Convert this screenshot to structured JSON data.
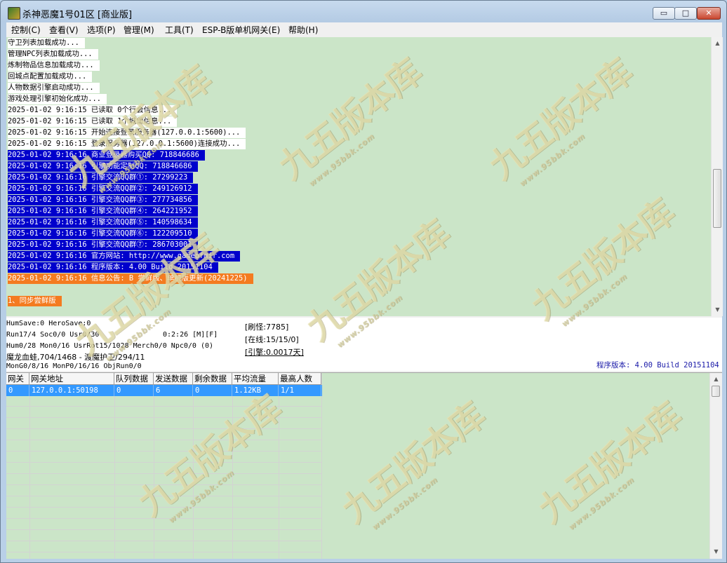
{
  "window": {
    "title": "杀神恶魔1号01区 [商业版]",
    "controls": {
      "minimize": "▭",
      "maximize": "□",
      "close": "✕"
    }
  },
  "menu": [
    "控制(C)",
    "查看(V)",
    "选项(P)",
    "管理(M)",
    "工具(T)",
    "ESP-B版单机网关(E)",
    "帮助(H)"
  ],
  "log": [
    {
      "text": "守卫列表加载成功...",
      "style": "white"
    },
    {
      "text": "管理NPC列表加载成功...",
      "style": "white"
    },
    {
      "text": "炼制物品信息加载成功...",
      "style": "white"
    },
    {
      "text": "回城点配置加载成功...",
      "style": "white"
    },
    {
      "text": "人物数据引擎启动成功...",
      "style": "white"
    },
    {
      "text": "游戏处理引擎初始化成功...",
      "style": "white"
    },
    {
      "text": "2025-01-02 9:16:15 已读取 0个行会信息...",
      "style": "white"
    },
    {
      "text": "2025-01-02 9:16:15 已读取 1个城堡信息...",
      "style": "white"
    },
    {
      "text": "2025-01-02 9:16:15 开始连接登录服务器(127.0.0.1:5600)...",
      "style": "white"
    },
    {
      "text": "2025-01-02 9:16:15 登录服务器(127.0.0.1:5600)连接成功...",
      "style": "white"
    },
    {
      "text": "2025-01-02 9:16:16 商业登录器购买QQ: 718846686",
      "style": "blue"
    },
    {
      "text": "2025-01-02 9:16:16 引擎功能定制QQ: 718846686",
      "style": "blue"
    },
    {
      "text": "2025-01-02 9:16:16 引擎交流QQ群①: 27299223",
      "style": "blue"
    },
    {
      "text": "2025-01-02 9:16:16 引擎交流QQ群②: 249126912",
      "style": "blue"
    },
    {
      "text": "2025-01-02 9:16:16 引擎交流QQ群③: 277734856",
      "style": "blue"
    },
    {
      "text": "2025-01-02 9:16:16 引擎交流QQ群④: 264221952",
      "style": "blue"
    },
    {
      "text": "2025-01-02 9:16:16 引擎交流QQ群⑤: 140598634",
      "style": "blue"
    },
    {
      "text": "2025-01-02 9:16:16 引擎交流QQ群⑥: 122209510",
      "style": "blue"
    },
    {
      "text": "2025-01-02 9:16:16 引擎交流QQ群⑦: 286703001",
      "style": "blue"
    },
    {
      "text": "2025-01-02 9:16:16 官方网站: http://www.gameofmir.com",
      "style": "blue"
    },
    {
      "text": "2025-01-02 9:16:16 程序版本: 4.00 Build 20151104",
      "style": "blue"
    },
    {
      "text": "2025-01-02 9:16:16 信息公告: B 尝鲜版、单机版更新(20241225)",
      "style": "orange"
    },
    {
      "text": "",
      "style": "plain"
    },
    {
      "text": "1、同步尝鲜版",
      "style": "orange"
    }
  ],
  "status": {
    "line1": "HumSave:0 HeroSave:0",
    "line2": "Run17/4 Soc0/0 Usr0/30",
    "time": "0:2:26 [M][F]",
    "line3": "Hum0/28 Mon0/16 UsrRot15/1028 Merch0/0 Npc0/0 (0)",
    "line4": "魔龙血蛙,704/1468 - 渡魔护卫/294/11",
    "line5": "MonG0/8/16 MonP0/16/16 ObjRun0/0",
    "refresh": "[刷怪:7785]",
    "online": "[在线:15/15/0]",
    "engine": "[引擎:0.0017天]",
    "version": "程序版本: 4.00 Build 20151104"
  },
  "gateway_table": {
    "columns": [
      "网关",
      "网关地址",
      "队列数据",
      "发送数据",
      "剩余数据",
      "平均流量",
      "最高人数"
    ],
    "rows": [
      [
        "0",
        "127.0.0.1:50198",
        "0",
        "6",
        "0",
        "1.12KB",
        "1/1"
      ]
    ]
  },
  "watermark": {
    "text": "九五版本库",
    "url": "www.95bbk.com"
  }
}
